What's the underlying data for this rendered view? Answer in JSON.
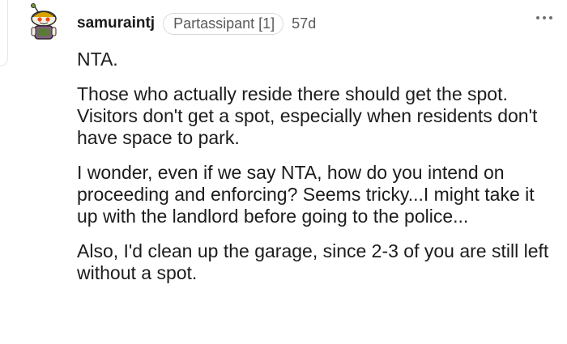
{
  "comment": {
    "username": "samuraintj",
    "flair": "Partassipant [1]",
    "age": "57d",
    "paragraphs": [
      "NTA.",
      "Those who actually reside there should get the spot. Visitors don't get a spot, especially when residents don't have space to park.",
      "I wonder, even if we say NTA, how do you intend on proceeding and enforcing? Seems tricky...I might take it up with the landlord before going to the police...",
      "Also, I'd clean up the garage, since 2-3 of you are still left without a spot."
    ],
    "avatar_icon": "snoo-avatar-icon",
    "more_icon": "more-options-icon"
  }
}
